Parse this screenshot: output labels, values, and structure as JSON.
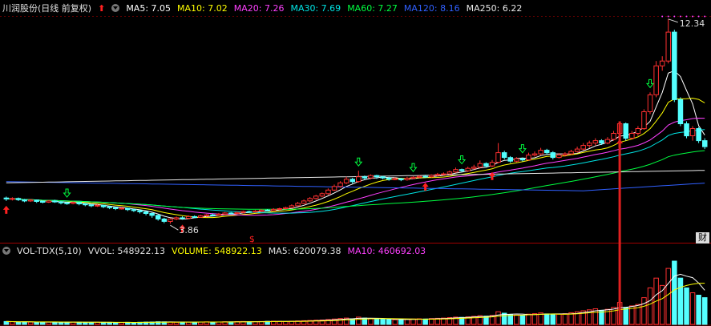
{
  "price_panel": {
    "title": "川润股份(日线 前复权)",
    "indicators": [
      {
        "label": "MA5: 7.05",
        "color": "#ffffff"
      },
      {
        "label": "MA10: 7.02",
        "color": "#ffff00"
      },
      {
        "label": "MA20: 7.26",
        "color": "#ff40ff"
      },
      {
        "label": "MA30: 7.69",
        "color": "#00e5e5"
      },
      {
        "label": "MA60: 7.27",
        "color": "#00ff40"
      },
      {
        "label": "MA120: 8.16",
        "color": "#3060ff"
      },
      {
        "label": "MA250: 6.22",
        "color": "#e8e8e8"
      }
    ],
    "high_label": "12.34",
    "low_label": "3.86",
    "dollar_mark": "$",
    "badge": "财"
  },
  "volume_panel": {
    "title": "VOL-TDX(5,10)",
    "indicators": [
      {
        "label": "VVOL: 548922.13",
        "color": "#e0e0e0"
      },
      {
        "label": "VOLUME: 548922.13",
        "color": "#ffff00"
      },
      {
        "label": "MA5: 620079.38",
        "color": "#e0e0e0"
      },
      {
        "label": "MA10: 460692.03",
        "color": "#ff40ff"
      }
    ]
  },
  "chart_data": {
    "type": "candlestick",
    "colors": {
      "up": "#ff3030",
      "down": "#54ffff",
      "bg": "#000000"
    },
    "price_range": [
      3.5,
      12.6
    ],
    "candles": [
      [
        4.92,
        4.88,
        4.98,
        4.8
      ],
      [
        4.88,
        4.9,
        4.95,
        4.82
      ],
      [
        4.9,
        4.85,
        4.94,
        4.8
      ],
      [
        4.85,
        4.8,
        4.88,
        4.75
      ],
      [
        4.8,
        4.84,
        4.88,
        4.76
      ],
      [
        4.84,
        4.78,
        4.86,
        4.72
      ],
      [
        4.78,
        4.75,
        4.82,
        4.7
      ],
      [
        4.75,
        4.8,
        4.84,
        4.72
      ],
      [
        4.8,
        4.76,
        4.85,
        4.72
      ],
      [
        4.76,
        4.72,
        4.8,
        4.66
      ],
      [
        4.72,
        4.7,
        4.76,
        4.64
      ],
      [
        4.7,
        4.74,
        4.78,
        4.66
      ],
      [
        4.74,
        4.68,
        4.76,
        4.62
      ],
      [
        4.68,
        4.64,
        4.72,
        4.58
      ],
      [
        4.64,
        4.6,
        4.68,
        4.54
      ],
      [
        4.6,
        4.62,
        4.66,
        4.55
      ],
      [
        4.62,
        4.56,
        4.64,
        4.5
      ],
      [
        4.56,
        4.52,
        4.6,
        4.46
      ],
      [
        4.52,
        4.48,
        4.55,
        4.42
      ],
      [
        4.48,
        4.5,
        4.54,
        4.44
      ],
      [
        4.5,
        4.44,
        4.52,
        4.38
      ],
      [
        4.44,
        4.4,
        4.48,
        4.34
      ],
      [
        4.4,
        4.35,
        4.44,
        4.28
      ],
      [
        4.35,
        4.28,
        4.38,
        4.2
      ],
      [
        4.28,
        4.2,
        4.32,
        4.1
      ],
      [
        4.2,
        4.05,
        4.24,
        3.98
      ],
      [
        4.05,
        3.95,
        4.1,
        3.88
      ],
      [
        3.95,
        4.05,
        4.08,
        3.86
      ],
      [
        4.05,
        4.1,
        4.15,
        4.0
      ],
      [
        4.1,
        4.08,
        4.16,
        4.02
      ],
      [
        4.08,
        4.15,
        4.2,
        4.04
      ],
      [
        4.15,
        4.12,
        4.2,
        4.08
      ],
      [
        4.12,
        4.18,
        4.22,
        4.1
      ],
      [
        4.18,
        4.22,
        4.26,
        4.14
      ],
      [
        4.22,
        4.2,
        4.28,
        4.16
      ],
      [
        4.2,
        4.25,
        4.3,
        4.18
      ],
      [
        4.25,
        4.3,
        4.34,
        4.22
      ],
      [
        4.3,
        4.28,
        4.34,
        4.24
      ],
      [
        4.28,
        4.32,
        4.36,
        4.26
      ],
      [
        4.32,
        4.36,
        4.4,
        4.28
      ],
      [
        4.36,
        4.34,
        4.4,
        4.3
      ],
      [
        4.34,
        4.38,
        4.42,
        4.32
      ],
      [
        4.38,
        4.42,
        4.46,
        4.34
      ],
      [
        4.42,
        4.4,
        4.46,
        4.36
      ],
      [
        4.4,
        4.45,
        4.5,
        4.38
      ],
      [
        4.45,
        4.48,
        4.52,
        4.42
      ],
      [
        4.48,
        4.52,
        4.56,
        4.44
      ],
      [
        4.52,
        4.6,
        4.66,
        4.5
      ],
      [
        4.6,
        4.7,
        4.76,
        4.58
      ],
      [
        4.7,
        4.8,
        4.86,
        4.66
      ],
      [
        4.8,
        4.9,
        4.96,
        4.76
      ],
      [
        4.9,
        5.0,
        5.05,
        4.85
      ],
      [
        5.0,
        5.1,
        5.15,
        4.95
      ],
      [
        5.1,
        5.25,
        5.32,
        5.05
      ],
      [
        5.25,
        5.4,
        5.48,
        5.2
      ],
      [
        5.4,
        5.55,
        5.62,
        5.35
      ],
      [
        5.55,
        5.7,
        5.8,
        5.5
      ],
      [
        5.7,
        5.6,
        5.76,
        5.52
      ],
      [
        5.6,
        5.8,
        6.05,
        5.56
      ],
      [
        5.8,
        5.75,
        5.85,
        5.68
      ],
      [
        5.75,
        5.85,
        5.9,
        5.7
      ],
      [
        5.85,
        5.8,
        5.88,
        5.72
      ],
      [
        5.8,
        5.75,
        5.84,
        5.7
      ],
      [
        5.75,
        5.7,
        5.8,
        5.64
      ],
      [
        5.7,
        5.72,
        5.78,
        5.66
      ],
      [
        5.72,
        5.68,
        5.76,
        5.62
      ],
      [
        5.68,
        5.74,
        5.8,
        5.64
      ],
      [
        5.74,
        5.78,
        5.82,
        5.7
      ],
      [
        5.78,
        5.82,
        5.86,
        5.74
      ],
      [
        5.82,
        5.8,
        5.88,
        5.76
      ],
      [
        5.8,
        5.86,
        5.9,
        5.76
      ],
      [
        5.86,
        5.9,
        5.96,
        5.82
      ],
      [
        5.9,
        5.92,
        5.98,
        5.86
      ],
      [
        5.92,
        6.0,
        6.06,
        5.88
      ],
      [
        6.0,
        6.1,
        6.18,
        5.96
      ],
      [
        6.1,
        6.05,
        6.14,
        6.0
      ],
      [
        6.05,
        6.15,
        6.22,
        6.0
      ],
      [
        6.15,
        6.2,
        6.3,
        6.1
      ],
      [
        6.2,
        6.35,
        6.48,
        6.16
      ],
      [
        6.35,
        6.25,
        6.4,
        6.18
      ],
      [
        6.25,
        6.4,
        6.5,
        6.2
      ],
      [
        6.4,
        6.8,
        7.2,
        6.36
      ],
      [
        6.8,
        6.6,
        6.88,
        6.52
      ],
      [
        6.6,
        6.45,
        6.66,
        6.38
      ],
      [
        6.45,
        6.55,
        6.62,
        6.4
      ],
      [
        6.55,
        6.5,
        6.6,
        6.44
      ],
      [
        6.5,
        6.7,
        6.8,
        6.46
      ],
      [
        6.7,
        6.75,
        6.85,
        6.64
      ],
      [
        6.75,
        6.9,
        7.0,
        6.7
      ],
      [
        6.9,
        6.8,
        6.96,
        6.72
      ],
      [
        6.8,
        6.6,
        6.86,
        6.52
      ],
      [
        6.6,
        6.7,
        6.78,
        6.56
      ],
      [
        6.7,
        6.75,
        6.82,
        6.64
      ],
      [
        6.75,
        6.85,
        6.92,
        6.7
      ],
      [
        6.85,
        6.95,
        7.05,
        6.8
      ],
      [
        6.95,
        7.1,
        7.2,
        6.9
      ],
      [
        7.1,
        7.2,
        7.3,
        7.0
      ],
      [
        7.2,
        7.3,
        7.4,
        7.1
      ],
      [
        7.3,
        7.2,
        7.36,
        7.12
      ],
      [
        7.2,
        7.35,
        7.45,
        7.15
      ],
      [
        7.35,
        7.6,
        7.7,
        7.3
      ],
      [
        7.6,
        8.0,
        8.1,
        7.55
      ],
      [
        8.0,
        7.4,
        8.05,
        7.3
      ],
      [
        7.4,
        7.6,
        7.7,
        7.35
      ],
      [
        7.6,
        7.8,
        7.9,
        7.5
      ],
      [
        7.8,
        8.5,
        8.6,
        7.75
      ],
      [
        8.5,
        9.2,
        9.3,
        8.4
      ],
      [
        9.2,
        10.4,
        10.6,
        9.1
      ],
      [
        10.4,
        10.6,
        10.8,
        10.2
      ],
      [
        10.6,
        11.8,
        12.34,
        10.5
      ],
      [
        11.8,
        9.0,
        11.9,
        8.9
      ],
      [
        9.0,
        8.0,
        9.1,
        7.9
      ],
      [
        8.0,
        7.5,
        8.1,
        7.4
      ],
      [
        7.5,
        7.8,
        7.9,
        7.3
      ],
      [
        7.8,
        7.3,
        7.86,
        7.2
      ],
      [
        7.3,
        7.05,
        7.4,
        6.95
      ]
    ],
    "volume": [
      120,
      110,
      100,
      105,
      95,
      90,
      100,
      95,
      90,
      85,
      95,
      100,
      90,
      85,
      80,
      90,
      85,
      80,
      75,
      80,
      85,
      80,
      90,
      95,
      100,
      110,
      105,
      95,
      90,
      100,
      95,
      90,
      100,
      105,
      95,
      100,
      110,
      105,
      115,
      120,
      110,
      115,
      120,
      125,
      130,
      125,
      120,
      130,
      140,
      150,
      160,
      170,
      180,
      200,
      220,
      240,
      260,
      230,
      300,
      260,
      240,
      220,
      210,
      200,
      190,
      200,
      210,
      220,
      230,
      220,
      240,
      250,
      260,
      280,
      300,
      290,
      310,
      330,
      360,
      340,
      370,
      520,
      460,
      400,
      380,
      360,
      420,
      440,
      470,
      430,
      400,
      420,
      440,
      480,
      520,
      560,
      600,
      640,
      580,
      620,
      700,
      900,
      700,
      760,
      820,
      1100,
      1500,
      1900,
      1600,
      2300,
      2600,
      1900,
      1500,
      1300,
      1200,
      1100
    ],
    "signals": {
      "up_arrows": [
        0,
        29,
        69,
        80,
        101
      ],
      "down_arrows": [
        10,
        58,
        67,
        75,
        85,
        106
      ]
    }
  }
}
